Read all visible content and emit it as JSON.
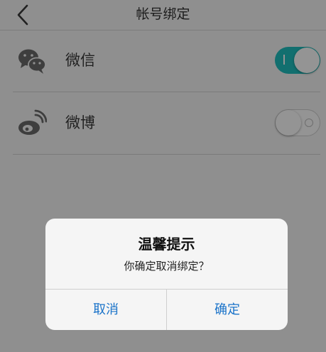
{
  "nav": {
    "title": "帐号绑定",
    "back_icon": "chevron-left-icon"
  },
  "accounts": [
    {
      "label": "微信",
      "icon": "wechat-icon",
      "bound": true
    },
    {
      "label": "微博",
      "icon": "weibo-icon",
      "bound": false
    }
  ],
  "dialog": {
    "title": "温馨提示",
    "message": "你确定取消绑定？",
    "cancel_label": "取消",
    "confirm_label": "确定"
  },
  "colors": {
    "accent": "#1fbfbf",
    "link": "#1a73c9",
    "icon": "#6b6b6b"
  }
}
